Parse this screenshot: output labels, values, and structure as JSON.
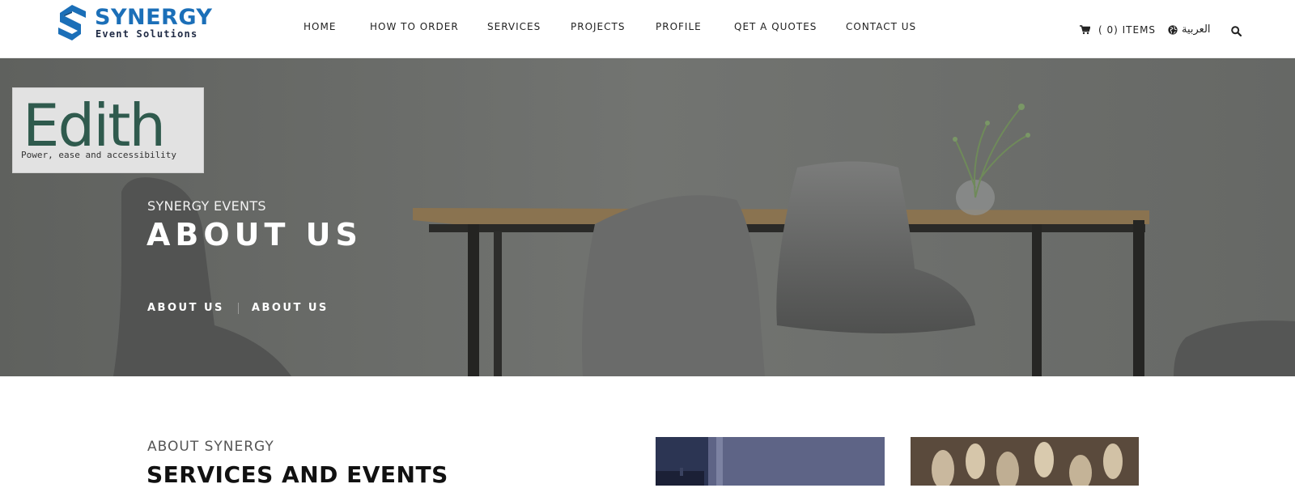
{
  "brand": {
    "name": "SYNERGY",
    "tagline": "Event Solutions",
    "colors": {
      "primary": "#1b6fb8",
      "dark": "#1f2a44"
    }
  },
  "nav": {
    "items": [
      {
        "label": "HOME"
      },
      {
        "label": "HOW TO ORDER"
      },
      {
        "label": "SERVICES"
      },
      {
        "label": "PROJECTS"
      },
      {
        "label": "PROFILE"
      },
      {
        "label": "QET A QUOTES"
      },
      {
        "label": "CONTACT US"
      }
    ]
  },
  "cart": {
    "icon": "cart-icon",
    "label": "( 0) ITEMS"
  },
  "language": {
    "icon": "globe-icon",
    "label": "العربية"
  },
  "search": {
    "icon": "search-icon"
  },
  "overlay_badge": {
    "word": "Edith",
    "tagline": "Power, ease and accessibility",
    "color": "#2f5a4d"
  },
  "hero": {
    "subtitle": "SYNERGY EVENTS",
    "title": "ABOUT US",
    "breadcrumbs": [
      "ABOUT US",
      "ABOUT US"
    ]
  },
  "about": {
    "kicker": "ABOUT SYNERGY",
    "title": "SERVICES AND EVENTS"
  }
}
